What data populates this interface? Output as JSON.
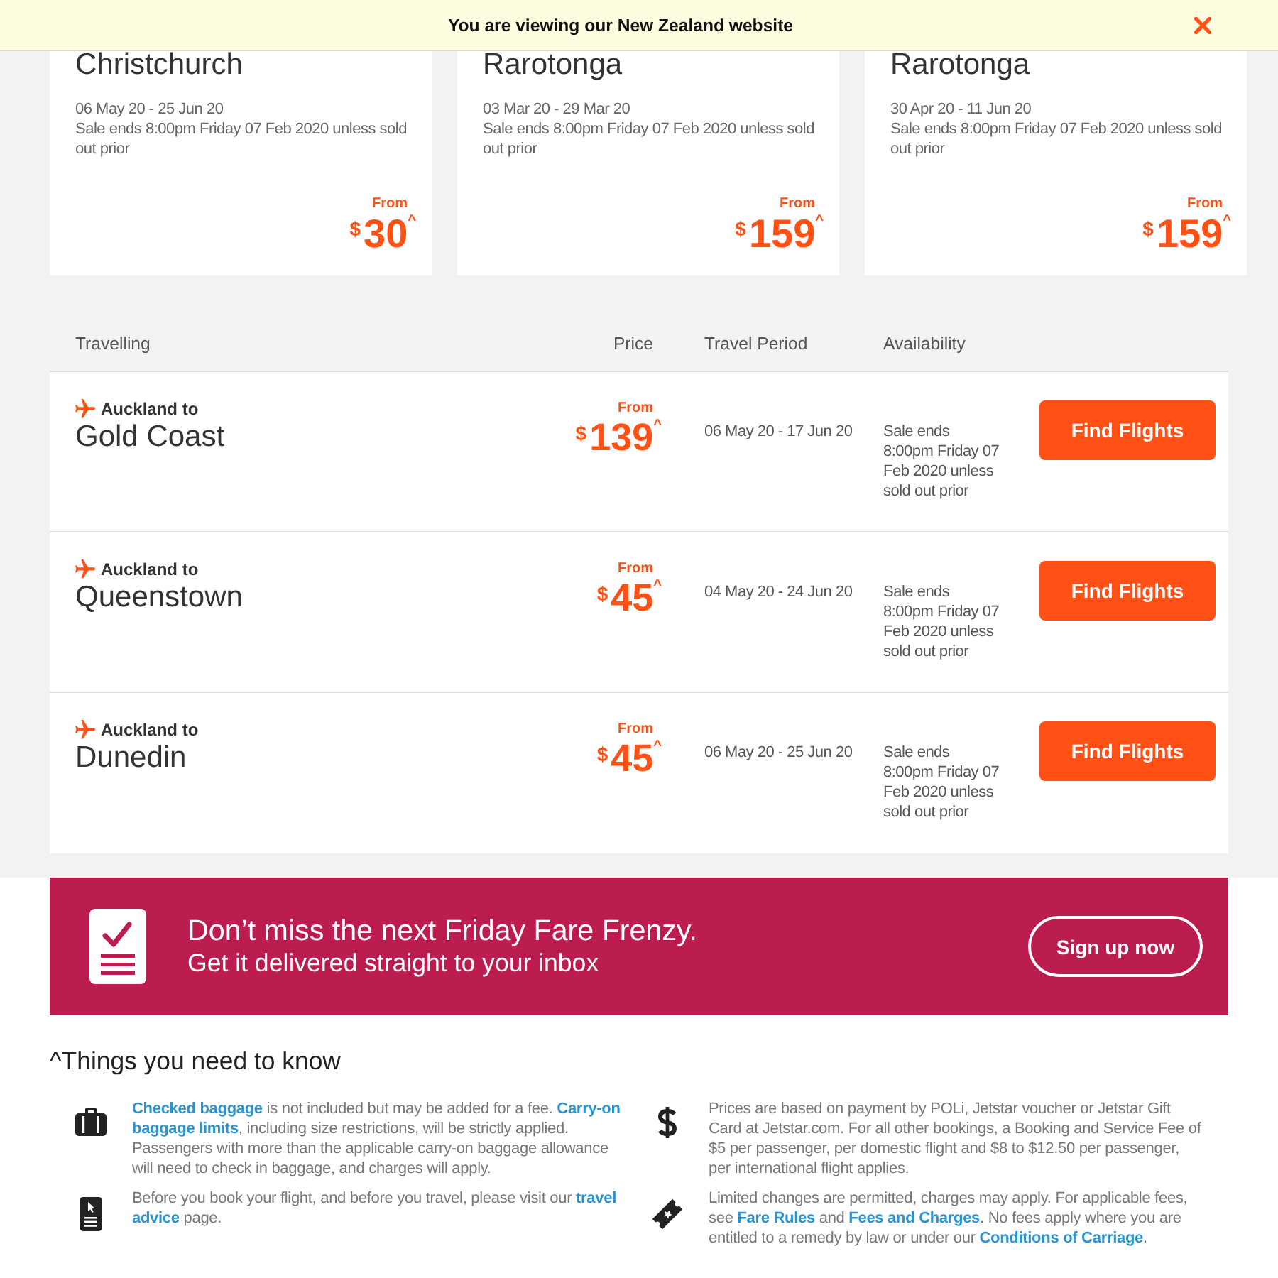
{
  "notice_bar": {
    "text": "You are viewing our New Zealand website"
  },
  "deal_cards": [
    {
      "destination": "Christchurch",
      "travel_period": "06 May 20 - 25 Jun 20",
      "sale_note": "Sale ends 8:00pm Friday 07 Feb 2020 unless sold out prior",
      "from_label": "From",
      "currency": "$",
      "amount": "30",
      "price_mark": "^"
    },
    {
      "destination": "Rarotonga",
      "travel_period": "03 Mar 20 - 29 Mar 20",
      "sale_note": "Sale ends 8:00pm Friday 07 Feb 2020 unless sold out prior",
      "from_label": "From",
      "currency": "$",
      "amount": "159",
      "price_mark": "^"
    },
    {
      "destination": "Rarotonga",
      "travel_period": "30 Apr 20 - 11 Jun 20",
      "sale_note": "Sale ends 8:00pm Friday 07 Feb 2020 unless sold out prior",
      "from_label": "From",
      "currency": "$",
      "amount": "159",
      "price_mark": "^"
    }
  ],
  "fares_table": {
    "columns": [
      "Travelling",
      "Price",
      "Travel Period",
      "Availability"
    ],
    "rows": [
      {
        "origin": "Auckland to",
        "destination": "Gold Coast",
        "from_label": "From",
        "currency": "$",
        "amount": "139",
        "price_mark": "^",
        "travel_period": "06 May 20 - 17 Jun 20",
        "availability": "Sale ends 8:00pm Friday 07 Feb 2020 unless sold out prior",
        "button": "Find Flights"
      },
      {
        "origin": "Auckland to",
        "destination": "Queenstown",
        "from_label": "From",
        "currency": "$",
        "amount": "45",
        "price_mark": "^",
        "travel_period": "04 May 20 - 24 Jun 20",
        "availability": "Sale ends 8:00pm Friday 07 Feb 2020 unless sold out prior",
        "button": "Find Flights"
      },
      {
        "origin": "Auckland to",
        "destination": "Dunedin",
        "from_label": "From",
        "currency": "$",
        "amount": "45",
        "price_mark": "^",
        "travel_period": "06 May 20 - 25 Jun 20",
        "availability": "Sale ends 8:00pm Friday 07 Feb 2020 unless sold out prior",
        "button": "Find Flights"
      }
    ]
  },
  "signup_banner": {
    "title": "Don’t miss the next Friday Fare Frenzy.",
    "subtitle": "Get it delivered straight to your inbox",
    "button": "Sign up now"
  },
  "things_to_know": {
    "heading": "^Things you need to know",
    "items": [
      {
        "kind": "baggage",
        "parts": [
          {
            "text": "Checked baggage",
            "kind": "link"
          },
          {
            "text": " is not included but may be added for a fee. ",
            "kind": "plain"
          },
          {
            "text": "Carry-on ",
            "kind": "link"
          },
          {
            "text": "baggage limits",
            "kind": "link"
          },
          {
            "text": ", including size restrictions, will be strictly applied. Passengers with more than the applicable carry-on baggage allowance will need to check in baggage, and charges will apply.",
            "kind": "plain"
          }
        ]
      },
      {
        "kind": "price",
        "parts": [
          {
            "text": "Prices are based on payment by POLi, Jetstar voucher or Jetstar Gift Card at Jetstar.com. For all other bookings, a Booking and Service Fee of $5 per passenger, per domestic flight and $8 to $12.50 per passenger, per international flight applies.",
            "kind": "plain"
          }
        ]
      },
      {
        "kind": "advice",
        "parts": [
          {
            "text": "Before you book your flight, and before you travel, please visit our ",
            "kind": "plain"
          },
          {
            "text": "travel ",
            "kind": "link"
          },
          {
            "text": "advice",
            "kind": "link"
          },
          {
            "text": " page.",
            "kind": "plain"
          }
        ]
      },
      {
        "kind": "changes",
        "parts": [
          {
            "text": "Limited changes are permitted, charges may apply. For applicable fees, see ",
            "kind": "plain"
          },
          {
            "text": "Fare Rules",
            "kind": "link"
          },
          {
            "text": " and ",
            "kind": "plain"
          },
          {
            "text": "Fees and Charges",
            "kind": "link"
          },
          {
            "text": ". No fees apply where you are entitled to a remedy by law or under our ",
            "kind": "plain"
          },
          {
            "text": "Conditions of Carriage",
            "kind": "link"
          },
          {
            "text": ".",
            "kind": "plain"
          }
        ]
      }
    ]
  }
}
